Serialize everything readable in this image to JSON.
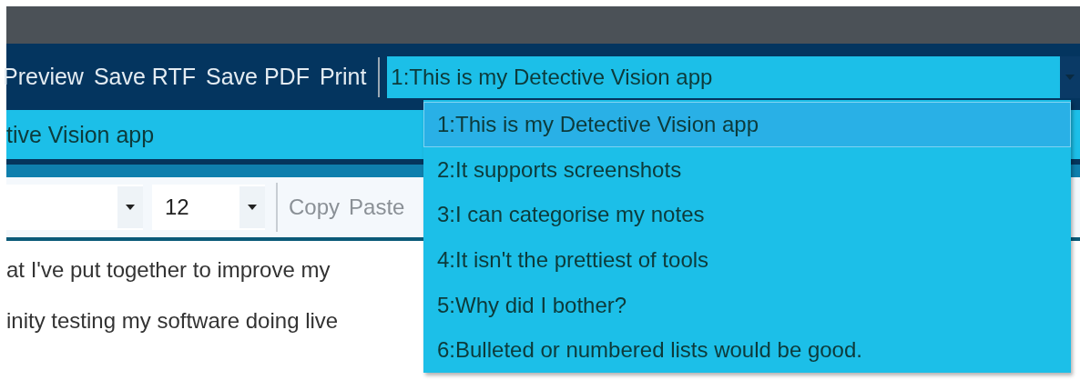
{
  "toolbar": {
    "buttons": [
      "Preview",
      "Save RTF",
      "Save PDF",
      "Print"
    ],
    "note_select": {
      "value": "1:This is my Detective Vision app",
      "expanded": true,
      "options": [
        {
          "label": "1:This is my Detective Vision app",
          "selected": true
        },
        {
          "label": "2:It supports screenshots",
          "selected": false
        },
        {
          "label": "3:I can categorise my notes",
          "selected": false
        },
        {
          "label": "4:It isn't the prettiest of tools",
          "selected": false
        },
        {
          "label": "5:Why did I bother?",
          "selected": false
        },
        {
          "label": "6:Bulleted or numbered lists would be good.",
          "selected": false
        }
      ]
    }
  },
  "note_title": "tive Vision app",
  "format_bar": {
    "font_size": "12",
    "actions": [
      "Copy",
      "Paste"
    ]
  },
  "body_lines": [
    "at I've put together to improve my",
    "inity testing my software doing live"
  ]
}
